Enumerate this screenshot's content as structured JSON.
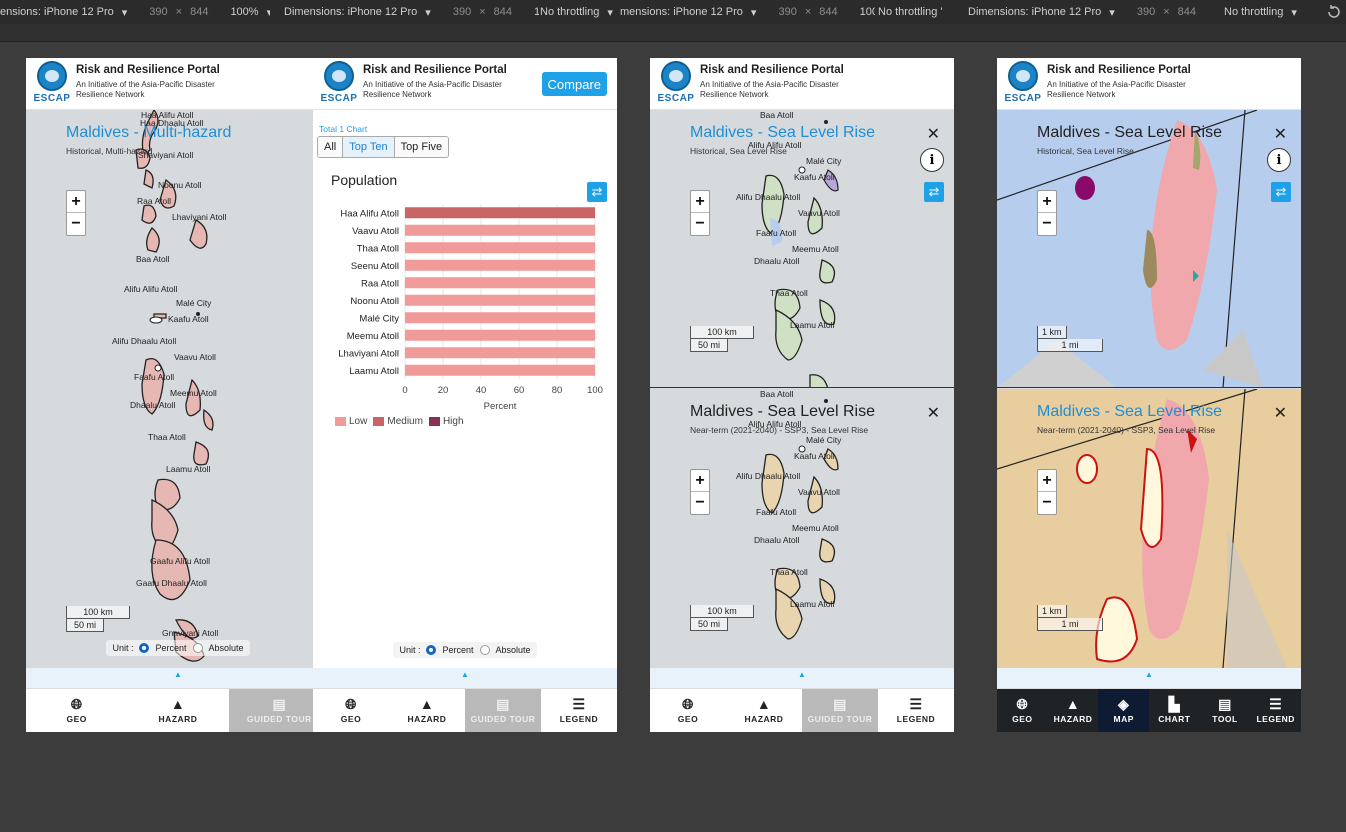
{
  "devtools": {
    "seg1": "ensions: iPhone 12 Pro",
    "seg_dimensions": "Dimensions: iPhone 12 Pro",
    "seg3": "mensions: iPhone 12 Pro",
    "width": "390",
    "times": "×",
    "height": "844",
    "zoom": "100%",
    "throttle": "No throttling",
    "throttle_cut": "No throttling '"
  },
  "app": {
    "title": "Risk and Resilience Portal",
    "subtitle": "An Initiative of the Asia-Pacific Disaster Resilience Network",
    "logo_text": "ESCAP",
    "compare": "Compare",
    "compare_cut": "C"
  },
  "panel1": {
    "map_title": "Maldives - Multi-hazard",
    "map_subtitle": "Historical, Multi-hazard",
    "labels": [
      "Haa Alifu Atoll",
      "Haa Dhaalu Atoll",
      "Shaviyani Atoll",
      "Noonu Atoll",
      "Raa Atoll",
      "Lhaviyani Atoll",
      "Baa Atoll",
      "Alifu Alifu Atoll",
      "Malé City",
      "Kaafu Atoll",
      "Alifu Dhaalu Atoll",
      "Vaavu Atoll",
      "Faafu Atoll",
      "Meemu Atoll",
      "Dhaalu Atoll",
      "Thaa Atoll",
      "Laamu Atoll",
      "Gaafu Alifu Atoll",
      "Gaafu Dhaalu Atoll",
      "Gnaviyani Atoll"
    ],
    "scale_km": "100 km",
    "scale_mi": "50 mi"
  },
  "unit": {
    "label": "Unit :",
    "percent": "Percent",
    "absolute": "Absolute"
  },
  "nav": {
    "geo": "GEO",
    "hazard": "HAZARD",
    "guided_tour": "GUIDED TOUR",
    "legend": "LEGEND",
    "map": "MAP",
    "chart": "CHART",
    "tool": "TOOL"
  },
  "panel2": {
    "total": "Total 1 Chart",
    "tabs": [
      "All",
      "Top Ten",
      "Top Five"
    ],
    "active_tab": "Top Ten",
    "legend": [
      "Low",
      "Medium",
      "High"
    ]
  },
  "chart_data": {
    "type": "bar",
    "orientation": "horizontal",
    "title": "Population",
    "xlabel": "Percent",
    "xlim": [
      0,
      100
    ],
    "xticks": [
      "0",
      "20",
      "40",
      "60",
      "80",
      "100"
    ],
    "categories": [
      "Haa Alifu Atoll",
      "Vaavu Atoll",
      "Thaa Atoll",
      "Seenu Atoll",
      "Raa Atoll",
      "Noonu Atoll",
      "Malé City",
      "Meemu Atoll",
      "Lhaviyani Atoll",
      "Laamu Atoll"
    ],
    "series": [
      {
        "name": "Low",
        "color": "#f09a9a",
        "values": [
          0,
          100,
          100,
          100,
          100,
          100,
          100,
          100,
          100,
          100
        ]
      },
      {
        "name": "Medium",
        "color": "#c86464",
        "values": [
          100,
          0,
          0,
          0,
          0,
          0,
          0,
          0,
          0,
          0
        ]
      },
      {
        "name": "High",
        "color": "#8a2f55",
        "values": [
          0,
          0,
          0,
          0,
          0,
          0,
          0,
          0,
          0,
          0
        ]
      }
    ]
  },
  "panel3": {
    "top_title": "Maldives - Sea Level Rise",
    "top_subtitle": "Historical, Sea Level Rise",
    "bottom_title": "Maldives - Sea Level Rise",
    "bottom_subtitle": "Near-term (2021-2040) - SSP3, Sea Level Rise",
    "labels": [
      "Baa Atoll",
      "Alifu Alifu Atoll",
      "Malé City",
      "Kaafu Atoll",
      "Alifu Dhaalu Atoll",
      "Vaavu Atoll",
      "Faafu Atoll",
      "Meemu Atoll",
      "Dhaalu Atoll",
      "Thaa Atoll",
      "Laamu Atoll"
    ],
    "scale_km": "100 km",
    "scale_mi": "50 mi"
  },
  "panel4": {
    "top_title": "Maldives - Sea Level Rise",
    "top_subtitle": "Historical, Sea Level Rise",
    "bottom_title": "Maldives - Sea Level Rise",
    "bottom_subtitle": "Near-term (2021-2040) - SSP3, Sea Level Rise",
    "scale_km": "1 km",
    "scale_mi": "1 mi"
  },
  "colors": {
    "accent": "#1ea1e6",
    "map_bg": "#d6dadc",
    "multi_hazard_fill": "#e6b8b4",
    "historical_fill": "#cfe0c4",
    "nearterm_fill": "#e8d5b0",
    "sea": "#b7cdee"
  },
  "icons": [
    "globe-icon",
    "warning-icon",
    "book-icon",
    "list-icon",
    "layers-icon",
    "chart-icon",
    "database-icon",
    "swap-icon",
    "info-icon",
    "close-icon",
    "rotate-icon"
  ]
}
